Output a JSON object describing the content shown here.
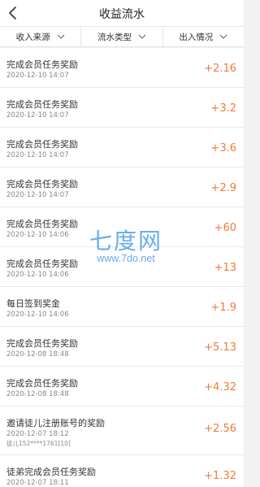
{
  "header": {
    "title": "收益流水",
    "back_icon": "chevron-left-icon"
  },
  "filters": [
    {
      "label": "收入来源",
      "icon": "chevron-down-icon"
    },
    {
      "label": "流水类型",
      "icon": "chevron-down-icon"
    },
    {
      "label": "出入情况",
      "icon": "chevron-down-icon"
    }
  ],
  "records": [
    {
      "title": "完成会员任务奖励",
      "date": "2020-12-10 14:07",
      "amount": "+2.16"
    },
    {
      "title": "完成会员任务奖励",
      "date": "2020-12-10 14:07",
      "amount": "+3.2"
    },
    {
      "title": "完成会员任务奖励",
      "date": "2020-12-10 14:07",
      "amount": "+3.6"
    },
    {
      "title": "完成会员任务奖励",
      "date": "2020-12-10 14:07",
      "amount": "+2.9"
    },
    {
      "title": "完成会员任务奖励",
      "date": "2020-12-10 14:06",
      "amount": "+60"
    },
    {
      "title": "完成会员任务奖励",
      "date": "2020-12-10 14:06",
      "amount": "+13"
    },
    {
      "title": "每日签到奖金",
      "date": "2020-12-10 14:06",
      "amount": "+1.9"
    },
    {
      "title": "完成会员任务奖励",
      "date": "2020-12-08 18:48",
      "amount": "+5.13"
    },
    {
      "title": "完成会员任务奖励",
      "date": "2020-12-08 18:48",
      "amount": "+4.32"
    },
    {
      "title": "邀请徒儿注册账号的奖励",
      "date": "2020-12-07 18:12",
      "extra": "徒儿152****1761[10]",
      "amount": "+2.56"
    },
    {
      "title": "徒弟完成会员任务奖励",
      "date": "2020-12-07 18:11",
      "amount": "+1.32"
    }
  ],
  "watermark": {
    "logo": "七度网",
    "url": "www.7do.net"
  },
  "colors": {
    "amount": "#f07b38",
    "background": "#f2f2f2",
    "watermark": "#4096e6"
  }
}
